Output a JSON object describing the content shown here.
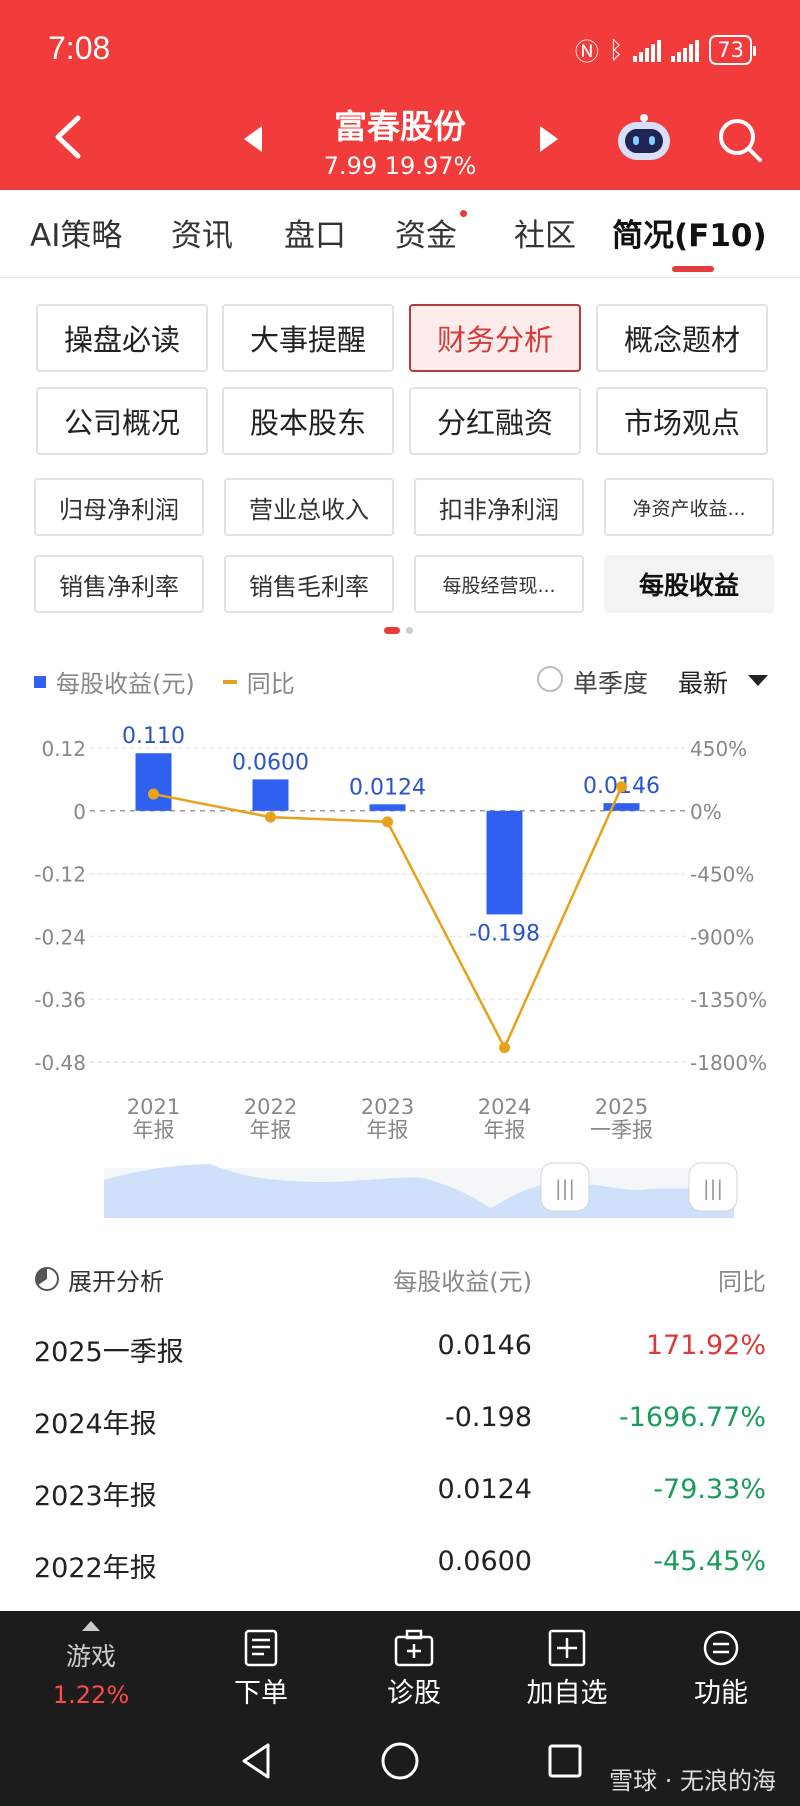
{
  "status": {
    "time": "7:08",
    "battery": "73"
  },
  "header": {
    "stock_name": "富春股份",
    "price_line": "7.99 19.97%"
  },
  "tabs": [
    {
      "label": "AI策略"
    },
    {
      "label": "资讯"
    },
    {
      "label": "盘口"
    },
    {
      "label": "资金"
    },
    {
      "label": "社区"
    },
    {
      "label": "简况(F10)"
    }
  ],
  "sections": [
    "操盘必读",
    "大事提醒",
    "财务分析",
    "概念题材",
    "公司概况",
    "股本股东",
    "分红融资",
    "市场观点"
  ],
  "metrics": [
    "归母净利润",
    "营业总收入",
    "扣非净利润",
    "净资产收益...",
    "销售净利率",
    "销售毛利率",
    "每股经营现...",
    "每股收益"
  ],
  "legend": {
    "bar": "每股收益(元)",
    "line": "同比"
  },
  "controls": {
    "single_quarter": "单季度",
    "period": "最新"
  },
  "chart_data": {
    "type": "bar",
    "categories": [
      [
        "2021",
        "年报"
      ],
      [
        "2022",
        "年报"
      ],
      [
        "2023",
        "年报"
      ],
      [
        "2024",
        "年报"
      ],
      [
        "2025",
        "一季报"
      ]
    ],
    "series": [
      {
        "name": "每股收益(元)",
        "kind": "bar",
        "axis": "left",
        "color": "#3060f0",
        "values": [
          0.11,
          0.06,
          0.0124,
          -0.198,
          0.0146
        ],
        "labels": [
          "0.110",
          "0.0600",
          "0.0124",
          "-0.198",
          "0.0146"
        ]
      },
      {
        "name": "同比",
        "kind": "line",
        "axis": "right",
        "color": "#e8a11a",
        "values": [
          120,
          -45.45,
          -79.33,
          -1696.77,
          171.92
        ]
      }
    ],
    "left_axis": {
      "ticks": [
        "0.12",
        "0",
        "-0.12",
        "-0.24",
        "-0.36",
        "-0.48"
      ],
      "range": [
        -0.48,
        0.12
      ]
    },
    "right_axis": {
      "ticks": [
        "450%",
        "0%",
        "-450%",
        "-900%",
        "-1350%",
        "-1800%"
      ],
      "range": [
        -1800,
        450
      ]
    }
  },
  "table": {
    "header": {
      "label": "展开分析",
      "eps": "每股收益(元)",
      "yoy": "同比"
    },
    "rows": [
      {
        "period": "2025一季报",
        "eps": "0.0146",
        "yoy": "171.92%",
        "dir": "pos"
      },
      {
        "period": "2024年报",
        "eps": "-0.198",
        "yoy": "-1696.77%",
        "dir": "neg"
      },
      {
        "period": "2023年报",
        "eps": "0.0124",
        "yoy": "-79.33%",
        "dir": "neg"
      },
      {
        "period": "2022年报",
        "eps": "0.0600",
        "yoy": "-45.45%",
        "dir": "neg"
      }
    ]
  },
  "bottom_nav": {
    "game_label": "游戏",
    "game_pct": "1.22%",
    "order": "下单",
    "diagnose": "诊股",
    "add_watch": "加自选",
    "functions": "功能"
  },
  "watermark": "雪球 · 无浪的海"
}
